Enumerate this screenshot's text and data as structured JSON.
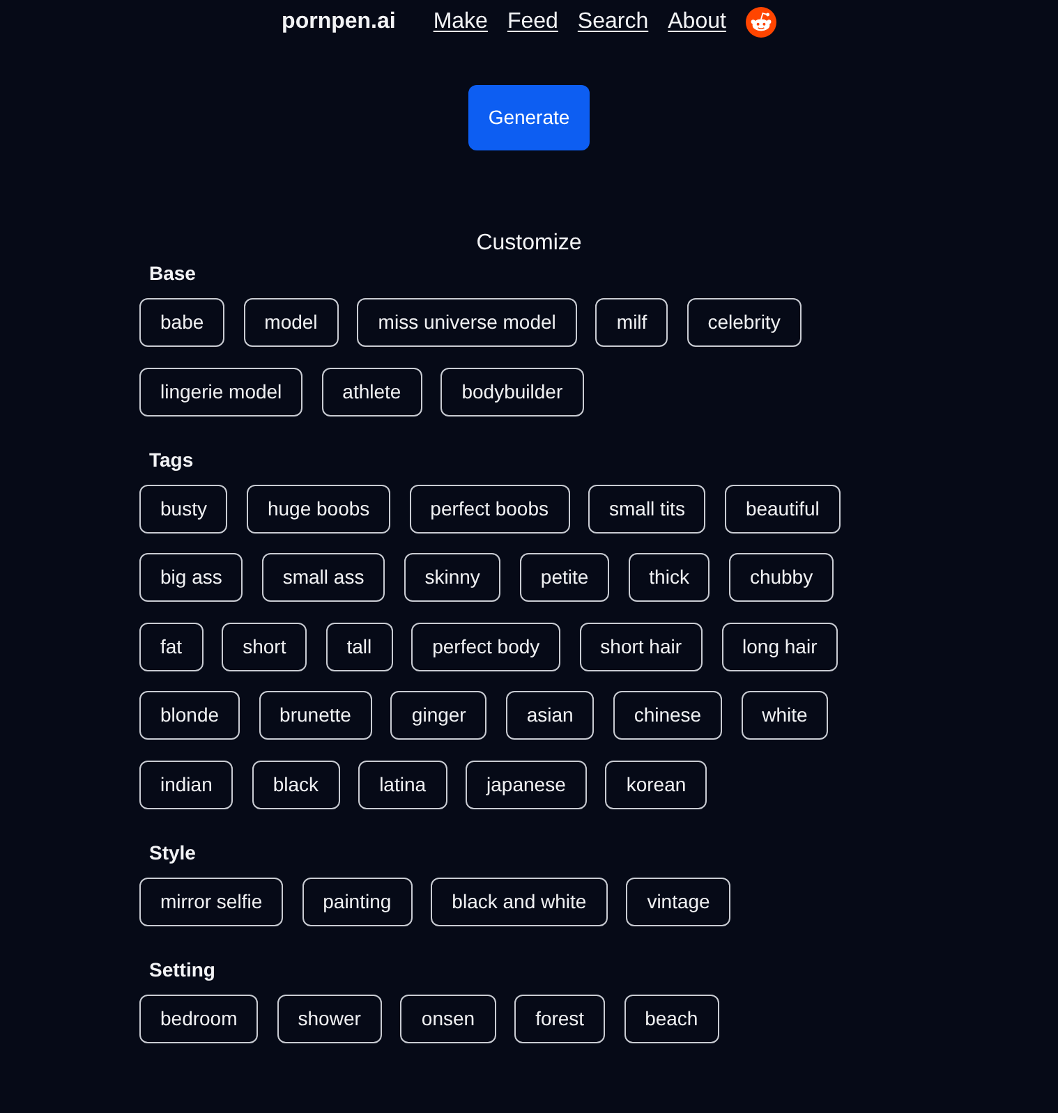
{
  "nav": {
    "brand": "pornpen.ai",
    "links": [
      "Make",
      "Feed",
      "Search",
      "About"
    ]
  },
  "generate_button": "Generate",
  "customize": {
    "title": "Customize",
    "sections": [
      {
        "title": "Base",
        "tags": [
          {
            "label": "babe",
            "selected": false
          },
          {
            "label": "model",
            "selected": false
          },
          {
            "label": "miss universe model",
            "selected": false
          },
          {
            "label": "milf",
            "selected": false
          },
          {
            "label": "celebrity",
            "selected": false
          },
          {
            "label": "lingerie model",
            "selected": false
          },
          {
            "label": "athlete",
            "selected": false
          },
          {
            "label": "bodybuilder",
            "selected": false
          }
        ]
      },
      {
        "title": "Tags",
        "tags": [
          {
            "label": "busty",
            "selected": false
          },
          {
            "label": "huge boobs",
            "selected": false
          },
          {
            "label": "perfect boobs",
            "selected": false
          },
          {
            "label": "small tits",
            "selected": false
          },
          {
            "label": "beautiful",
            "selected": false
          },
          {
            "label": "big ass",
            "selected": false
          },
          {
            "label": "small ass",
            "selected": false
          },
          {
            "label": "skinny",
            "selected": false
          },
          {
            "label": "petite",
            "selected": false
          },
          {
            "label": "thick",
            "selected": false
          },
          {
            "label": "chubby",
            "selected": false
          },
          {
            "label": "fat",
            "selected": false
          },
          {
            "label": "short",
            "selected": false
          },
          {
            "label": "tall",
            "selected": false
          },
          {
            "label": "perfect body",
            "selected": false
          },
          {
            "label": "short hair",
            "selected": false
          },
          {
            "label": "long hair",
            "selected": false
          },
          {
            "label": "blonde",
            "selected": false
          },
          {
            "label": "brunette",
            "selected": false
          },
          {
            "label": "ginger",
            "selected": false
          },
          {
            "label": "asian",
            "selected": false
          },
          {
            "label": "chinese",
            "selected": false
          },
          {
            "label": "white",
            "selected": false
          },
          {
            "label": "indian",
            "selected": false
          },
          {
            "label": "black",
            "selected": false
          },
          {
            "label": "latina",
            "selected": false
          },
          {
            "label": "japanese",
            "selected": false
          },
          {
            "label": "korean",
            "selected": false
          }
        ]
      },
      {
        "title": "Style",
        "tags": [
          {
            "label": "mirror selfie",
            "selected": false
          },
          {
            "label": "painting",
            "selected": false
          },
          {
            "label": "black and white",
            "selected": false
          },
          {
            "label": "vintage",
            "selected": false
          }
        ]
      },
      {
        "title": "Setting",
        "tags": [
          {
            "label": "bedroom",
            "selected": false
          },
          {
            "label": "shower",
            "selected": false
          },
          {
            "label": "onsen",
            "selected": false
          },
          {
            "label": "forest",
            "selected": false
          },
          {
            "label": "beach",
            "selected": false
          }
        ]
      }
    ]
  }
}
